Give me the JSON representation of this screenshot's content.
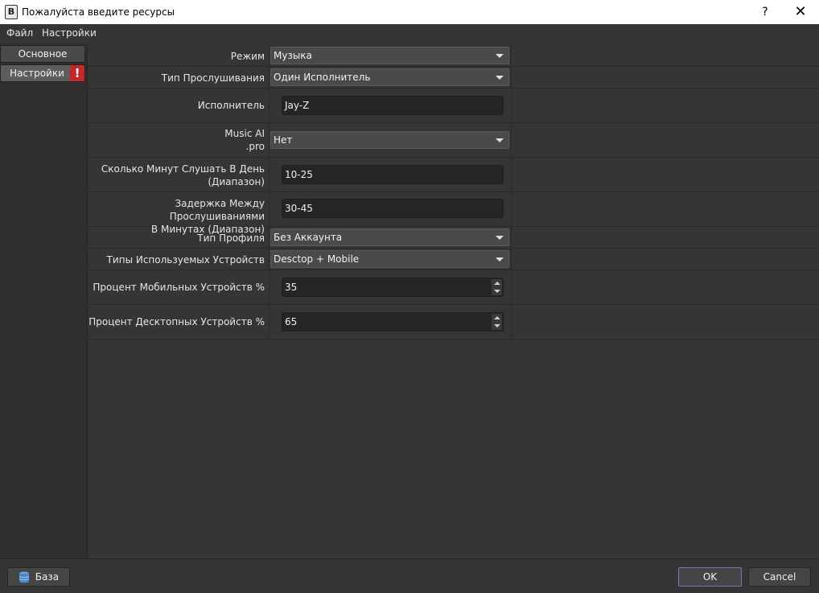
{
  "window": {
    "title": "Пожалуйста введите ресурсы",
    "help": "?",
    "close": "✕",
    "app_icon_letter": "B"
  },
  "menu": [
    "Файл",
    "Настройки"
  ],
  "nav": [
    {
      "label": "Основное",
      "active": false,
      "warning": false
    },
    {
      "label": "Настройки",
      "active": true,
      "warning": true,
      "warning_symbol": "!"
    }
  ],
  "form": {
    "mode": {
      "label": "Режим",
      "value": "Музыка"
    },
    "listen_type": {
      "label": "Тип Прослушивания",
      "value": "Один Исполнитель"
    },
    "artist": {
      "label": "Исполнитель",
      "value": "Jay-Z"
    },
    "music_ai": {
      "label_line1": "Music AI",
      "label_line2": ".pro",
      "value": "Нет"
    },
    "minutes_per_day": {
      "label_line1": "Сколько Минут Слушать В День",
      "label_line2": "(Диапазон)",
      "value": "10-25"
    },
    "delay": {
      "label_line1": "Задержка Между Прослушиваниями",
      "label_line2": "В Минутах (Диапазон)",
      "value": "30-45"
    },
    "profile_type": {
      "label": "Тип Профиля",
      "value": "Без Аккаунта"
    },
    "device_types": {
      "label": "Типы Используемых Устройств",
      "value": "Desctop + Mobile"
    },
    "mobile_percent": {
      "label": "Процент Мобильных Устройств %",
      "value": "35"
    },
    "desktop_percent": {
      "label": "Процент Десктопных Устройств %",
      "value": "65"
    }
  },
  "footer": {
    "db_button": "База",
    "ok": "OK",
    "cancel": "Cancel"
  },
  "colors": {
    "background": "#353535",
    "warning": "#c62828",
    "ok_border": "#8a6fb5"
  }
}
